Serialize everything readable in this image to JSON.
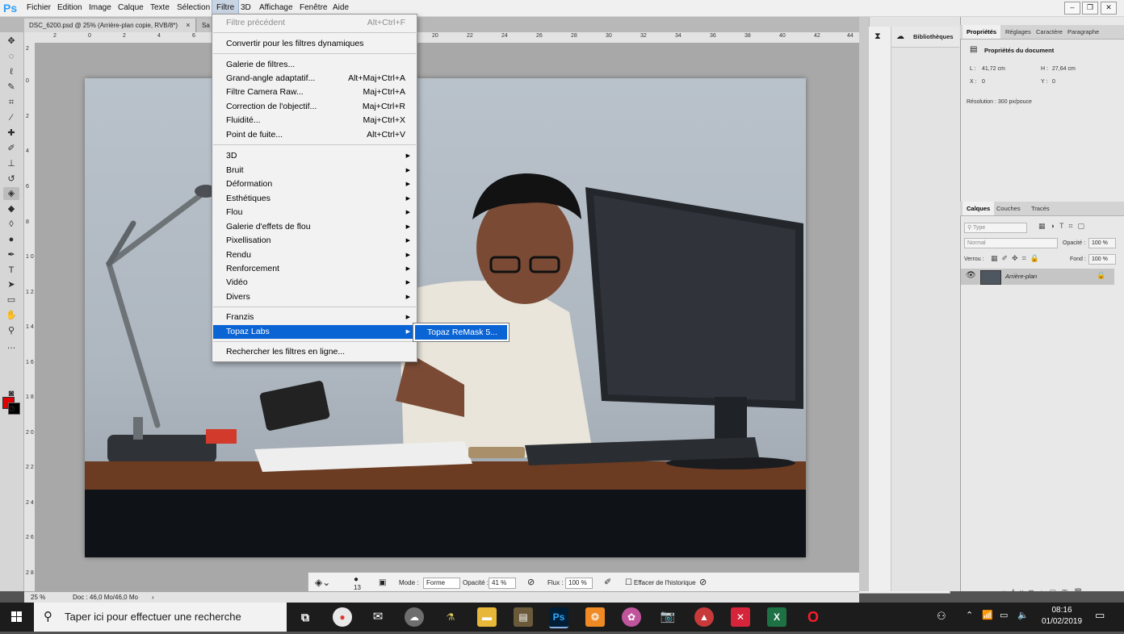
{
  "app": {
    "logo": "Ps",
    "menu": [
      "Fichier",
      "Edition",
      "Image",
      "Calque",
      "Texte",
      "Sélection",
      "Filtre",
      "3D",
      "Affichage",
      "Fenêtre",
      "Aide"
    ],
    "active_menu": "Filtre",
    "window_controls": [
      "minimize-icon",
      "restore-icon",
      "close-icon"
    ]
  },
  "tabs": [
    {
      "label": "DSC_6200.psd @ 25% (Arrière-plan copie, RVB/8*)",
      "close": "×"
    },
    {
      "label": "Sa",
      "close": ""
    }
  ],
  "ruler_top_ticks": [
    "2",
    "0",
    "2",
    "4",
    "6",
    "20",
    "22",
    "24",
    "26",
    "28",
    "30",
    "32",
    "34",
    "36",
    "38",
    "40",
    "42",
    "44"
  ],
  "ruler_left_ticks": [
    "2",
    "0",
    "2",
    "4",
    "6",
    "8",
    "1 0",
    "1 2",
    "1 4",
    "1 6",
    "1 8",
    "2 0",
    "2 2",
    "2 4",
    "2 6",
    "2 8"
  ],
  "filter_menu": {
    "items": [
      {
        "label": "Filtre précédent",
        "shortcut": "Alt+Ctrl+F",
        "disabled": true
      },
      {
        "label": "Convertir pour les filtres dynamiques",
        "shortcut": ""
      },
      {
        "label": "Galerie de filtres...",
        "shortcut": ""
      },
      {
        "label": "Grand-angle adaptatif...",
        "shortcut": "Alt+Maj+Ctrl+A"
      },
      {
        "label": "Filtre Camera Raw...",
        "shortcut": "Maj+Ctrl+A"
      },
      {
        "label": "Correction de l'objectif...",
        "shortcut": "Maj+Ctrl+R"
      },
      {
        "label": "Fluidité...",
        "shortcut": "Maj+Ctrl+X"
      },
      {
        "label": "Point de fuite...",
        "shortcut": "Alt+Ctrl+V"
      },
      {
        "label": "3D",
        "submenu": true
      },
      {
        "label": "Bruit",
        "submenu": true
      },
      {
        "label": "Déformation",
        "submenu": true
      },
      {
        "label": "Esthétiques",
        "submenu": true
      },
      {
        "label": "Flou",
        "submenu": true
      },
      {
        "label": "Galerie d'effets de flou",
        "submenu": true
      },
      {
        "label": "Pixellisation",
        "submenu": true
      },
      {
        "label": "Rendu",
        "submenu": true
      },
      {
        "label": "Renforcement",
        "submenu": true
      },
      {
        "label": "Vidéo",
        "submenu": true
      },
      {
        "label": "Divers",
        "submenu": true
      },
      {
        "label": "Franzis",
        "submenu": true
      },
      {
        "label": "Topaz Labs",
        "submenu": true,
        "highlighted": true
      },
      {
        "label": "Rechercher les filtres en ligne...",
        "shortcut": ""
      }
    ],
    "submenu_item": "Topaz ReMask 5..."
  },
  "brush_options": {
    "size": "13",
    "mode_label": "Mode :",
    "mode_value": "Forme",
    "opacity_label": "Opacité :",
    "opacity_value": "41 %",
    "flux_label": "Flux :",
    "flux_value": "100 %",
    "history_label": "Effacer de l'historique"
  },
  "status": {
    "zoom": "25 %",
    "doc": "Doc : 46,0 Mo/46,0 Mo"
  },
  "libraries": {
    "title": "Bibliothèques"
  },
  "properties": {
    "tabs": [
      "Propriétés",
      "Réglages",
      "Caractère",
      "Paragraphe"
    ],
    "title": "Propriétés du document",
    "l_label": "L :",
    "l_value": "41,72 cm",
    "h_label": "H :",
    "h_value": "27,64 cm",
    "x_label": "X :",
    "x_value": "0",
    "y_label": "Y :",
    "y_value": "0",
    "resolution": "Résolution : 300 px/pouce"
  },
  "layers": {
    "tabs": [
      "Calques",
      "Couches",
      "Tracés"
    ],
    "filter_placeholder": "Type",
    "blend_mode": "Normal",
    "opacity_label": "Opacité :",
    "opacity_value": "100 %",
    "lock_label": "Verrou :",
    "fill_label": "Fond :",
    "fill_value": "100 %",
    "layer_name": "Arrière-plan"
  },
  "taskbar": {
    "search_placeholder": "Taper ici pour effectuer une recherche",
    "time": "08:16",
    "date": "01/02/2019",
    "colors": {
      "photoshop": "#001e36",
      "accent": "#0a64d4"
    }
  }
}
